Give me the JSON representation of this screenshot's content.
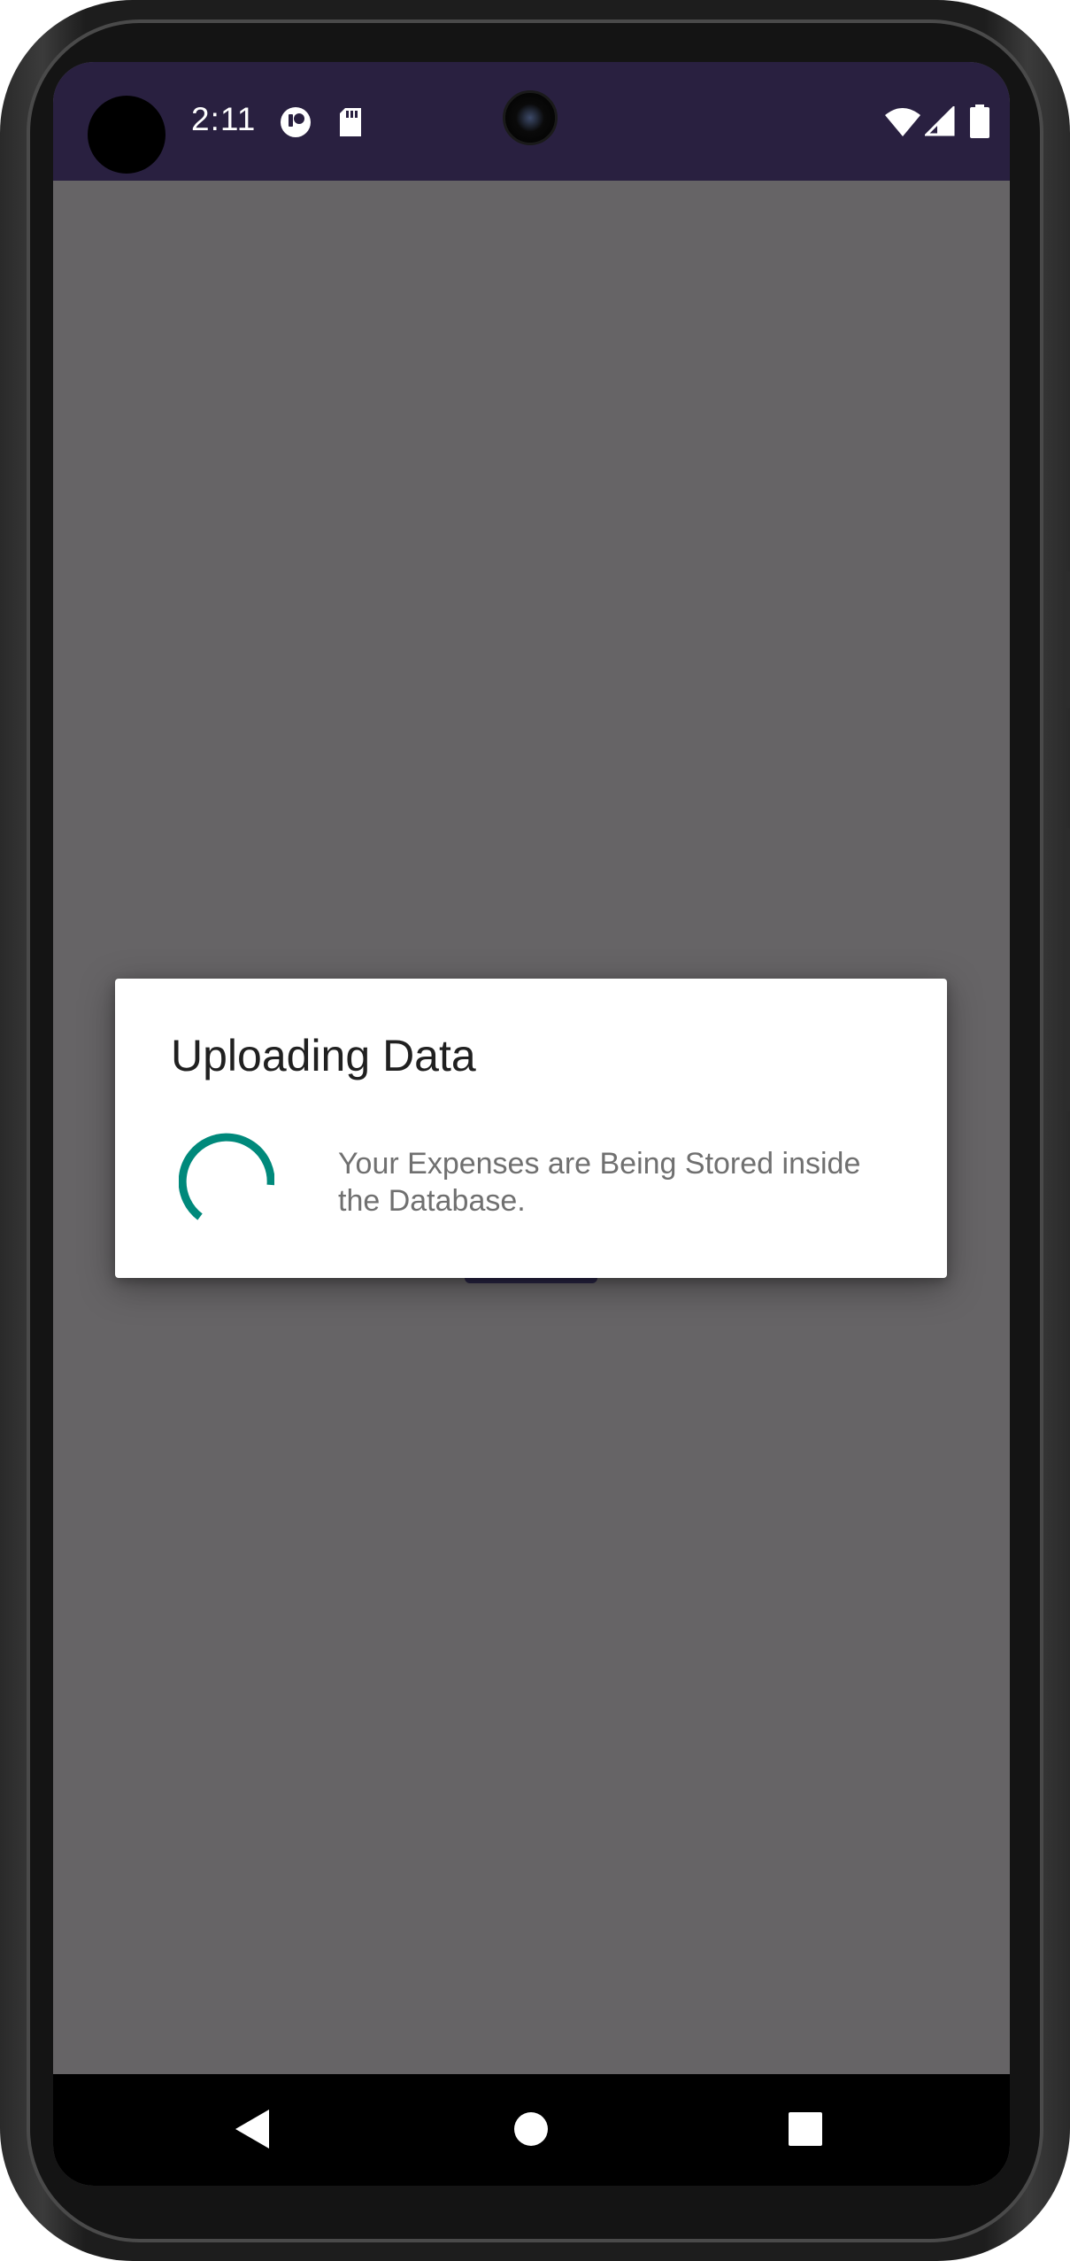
{
  "status_bar": {
    "time": "2:11",
    "icons": [
      "profile-avatar-icon",
      "data-saver-icon",
      "sd-card-icon",
      "wifi-icon",
      "signal-icon",
      "battery-icon"
    ]
  },
  "dialog": {
    "title": "Uploading Data",
    "message": "Your Expenses are Being Stored inside the Database.",
    "spinner_color": "#00897B"
  },
  "navigation": {
    "back": "back-icon",
    "home": "home-icon",
    "recents": "recents-icon"
  },
  "colors": {
    "status_bar": "#292040",
    "scrim": "#666466",
    "dialog_bg": "#FFFFFF",
    "accent": "#00897B"
  }
}
